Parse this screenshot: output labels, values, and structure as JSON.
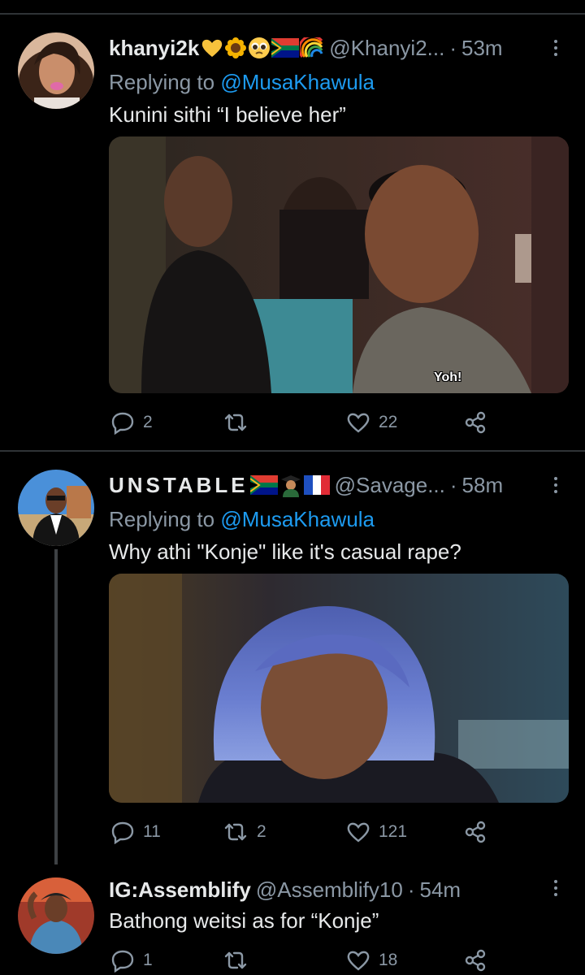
{
  "tweets": [
    {
      "name": "khanyi2k",
      "emojis": [
        "yellow-heart",
        "sunflower",
        "pleading-face",
        "south-africa-flag",
        "rainbow"
      ],
      "handle": "@Khanyi2...",
      "separator": "·",
      "time": "53m",
      "replying_prefix": "Replying to",
      "replying_to": "@MusaKhawula",
      "text": "Kunini sithi “I believe her”",
      "media_caption": "Yoh!",
      "stats": {
        "replies": "2",
        "retweets": "",
        "likes": "22"
      }
    },
    {
      "name": "UNSTABLE",
      "emojis": [
        "south-africa-flag",
        "student-emoji",
        "france-flag"
      ],
      "handle": "@Savage...",
      "separator": "·",
      "time": "58m",
      "replying_prefix": "Replying to",
      "replying_to": "@MusaKhawula",
      "text": "Why athi \"Konje\" like it's casual rape?",
      "stats": {
        "replies": "11",
        "retweets": "2",
        "likes": "121"
      }
    },
    {
      "name": "IG:Assemblify",
      "handle": "@Assemblify10",
      "separator": "·",
      "time": "54m",
      "text": "Bathong weitsi as for “Konje”",
      "stats": {
        "replies": "1",
        "retweets": "",
        "likes": "18"
      }
    }
  ],
  "colors": {
    "background": "#000000",
    "text": "#e7e9ea",
    "secondary": "#8b98a5",
    "link": "#1d9bf0",
    "divider": "#2f3336"
  }
}
